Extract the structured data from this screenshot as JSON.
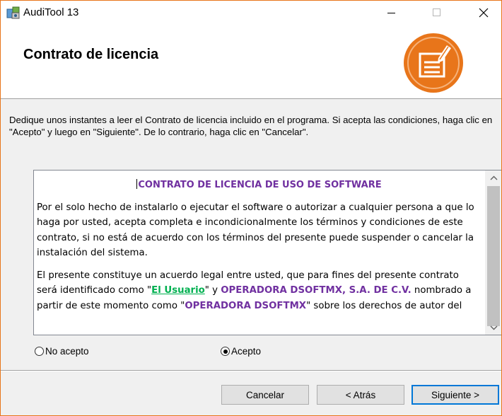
{
  "window": {
    "title": "AudiTool 13",
    "controls": {
      "minimize": "—",
      "maximize": "☐",
      "close": "✕"
    }
  },
  "header": {
    "title": "Contrato de licencia",
    "logo_icon": "document-pen-icon",
    "accent_color": "#e8751a"
  },
  "description": "Dedique unos instantes a leer el Contrato de licencia incluido en el programa. Si acepta las condiciones, haga clic en \"Acepto\" y luego en \"Siguiente\". De lo contrario, haga clic en \"Cancelar\".",
  "license": {
    "title": "CONTRATO DE LICENCIA DE USO DE SOFTWARE",
    "paragraph1": "Por el solo hecho de instalarlo o ejecutar el software o autorizar a cualquier persona a que lo haga por usted,  acepta completa e incondicionalmente los términos y condiciones de este contrato, si no está de acuerdo con los términos del presente puede suspender o cancelar la instalación del sistema.",
    "p2_a": "El presente constituye un acuerdo legal entre usted, que para fines del presente contrato será identificado como \"",
    "p2_user": "El Usuario",
    "p2_b": "\" y  ",
    "p2_company": "OPERADORA DSOFTMX, S.A. DE C.V.",
    "p2_c": " nombrado a partir de este momento  como \"",
    "p2_short": "OPERADORA DSOFTMX",
    "p2_d": "\" sobre los derechos de autor del"
  },
  "options": {
    "reject_label": "No acepto",
    "accept_label": "Acepto",
    "selected": "Acepto"
  },
  "buttons": {
    "cancel": "Cancelar",
    "back": "< Atrás",
    "next": "Siguiente >"
  }
}
